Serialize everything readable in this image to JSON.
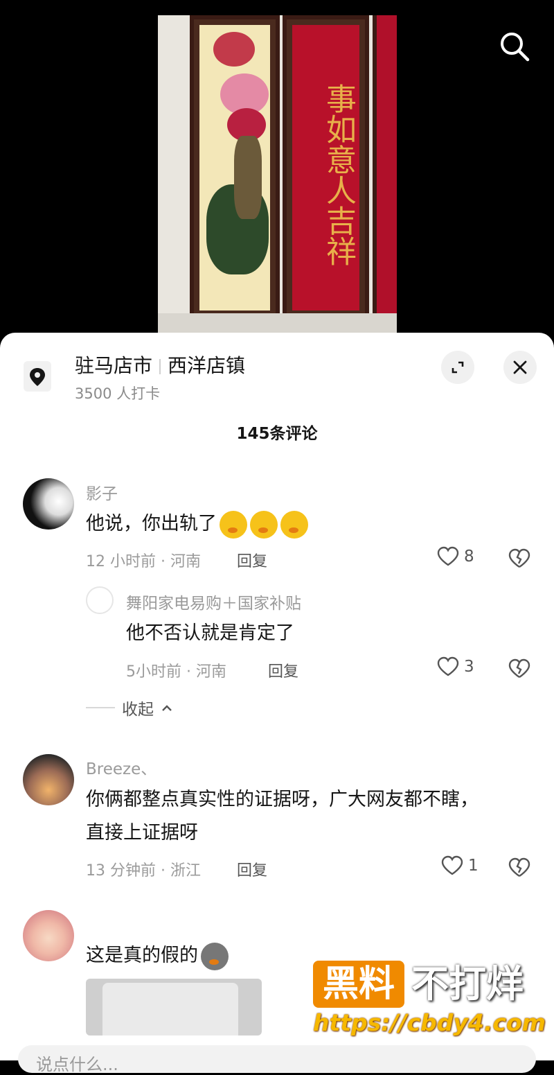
{
  "location": {
    "city": "驻马店市",
    "town": "西洋店镇",
    "checkins": "3500 人打卡"
  },
  "comments_count": "145条评论",
  "comments": [
    {
      "user": "影子",
      "text": "他说，你出轨了",
      "time_region": "12 小时前 · 河南",
      "reply_label": "回复",
      "likes": "8",
      "replies": [
        {
          "user": "舞阳家电易购＋国家补贴",
          "text": "他不否认就是肯定了",
          "time_region": "5小时前 · 河南",
          "reply_label": "回复",
          "likes": "3"
        }
      ],
      "collapse_label": "收起"
    },
    {
      "user": "Breeze、",
      "text_line1": "你俩都整点真实性的证据呀，广大网友都不瞎，",
      "text_line2": "直接上证据呀",
      "time_region": "13 分钟前 · 浙江",
      "reply_label": "回复",
      "likes": "1"
    },
    {
      "text": "这是真的假的"
    }
  ],
  "watermark": {
    "box": "黑料",
    "text": "不打烊",
    "url": "https://cbdy4.com"
  },
  "video": {
    "calligraphy": "事如意人吉祥"
  },
  "input": {
    "placeholder": "说点什么..."
  },
  "colors": {
    "accent_red": "#b8112a",
    "watermark_orange": "#f08a00"
  }
}
